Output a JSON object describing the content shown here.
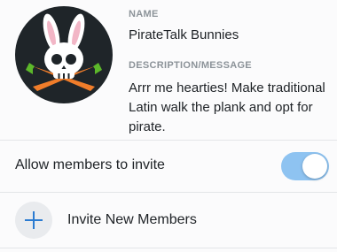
{
  "channel": {
    "name_label": "NAME",
    "name": "PirateTalk Bunnies",
    "description_label": "DESCRIPTION/MESSAGE",
    "description": "Arrr me hearties! Make traditional Latin walk the plank and opt for pirate.",
    "avatar_icon": "bunny-skull-crossed-carrots-icon"
  },
  "settings": {
    "allow_invite_label": "Allow members to invite",
    "allow_invite_enabled": true,
    "toggle_color": "#8ec3f1"
  },
  "invite": {
    "label": "Invite New Members",
    "icon": "plus-icon"
  },
  "colors": {
    "background": "#fbfbfc",
    "text": "#1e2226",
    "label": "#8c9399",
    "accent": "#2b7bd1",
    "divider": "#e3e5e8",
    "avatar_bg": "#1f2529",
    "carrot": "#f07d2a",
    "leaf": "#5cb82a"
  }
}
